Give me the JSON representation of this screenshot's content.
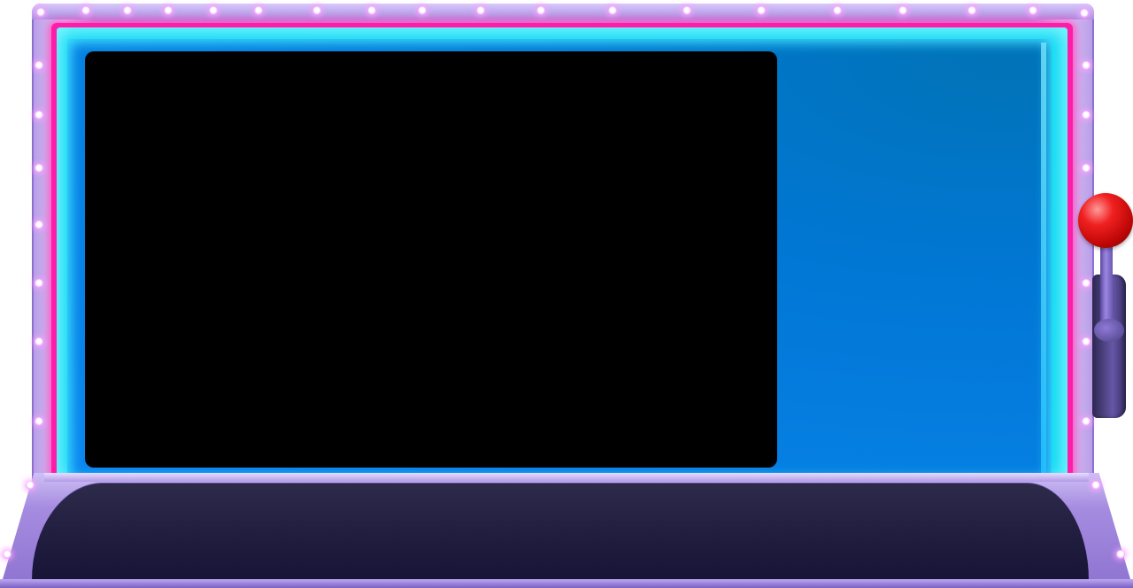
{
  "game": {
    "screen_state": "blank",
    "lever_action": "pull-lever"
  },
  "theme": {
    "frame_color": "#b49be4",
    "neon_pink": "#ff1ca8",
    "neon_cyan": "#10d8f2",
    "panel_blue": "#0177d4",
    "screen_color": "#000000",
    "console_color": "#1f1c3e",
    "lever_knob_color": "#e01515"
  },
  "icons": {
    "bulb": "marquee-bulb-icon",
    "lever": "lever-knob-icon"
  }
}
